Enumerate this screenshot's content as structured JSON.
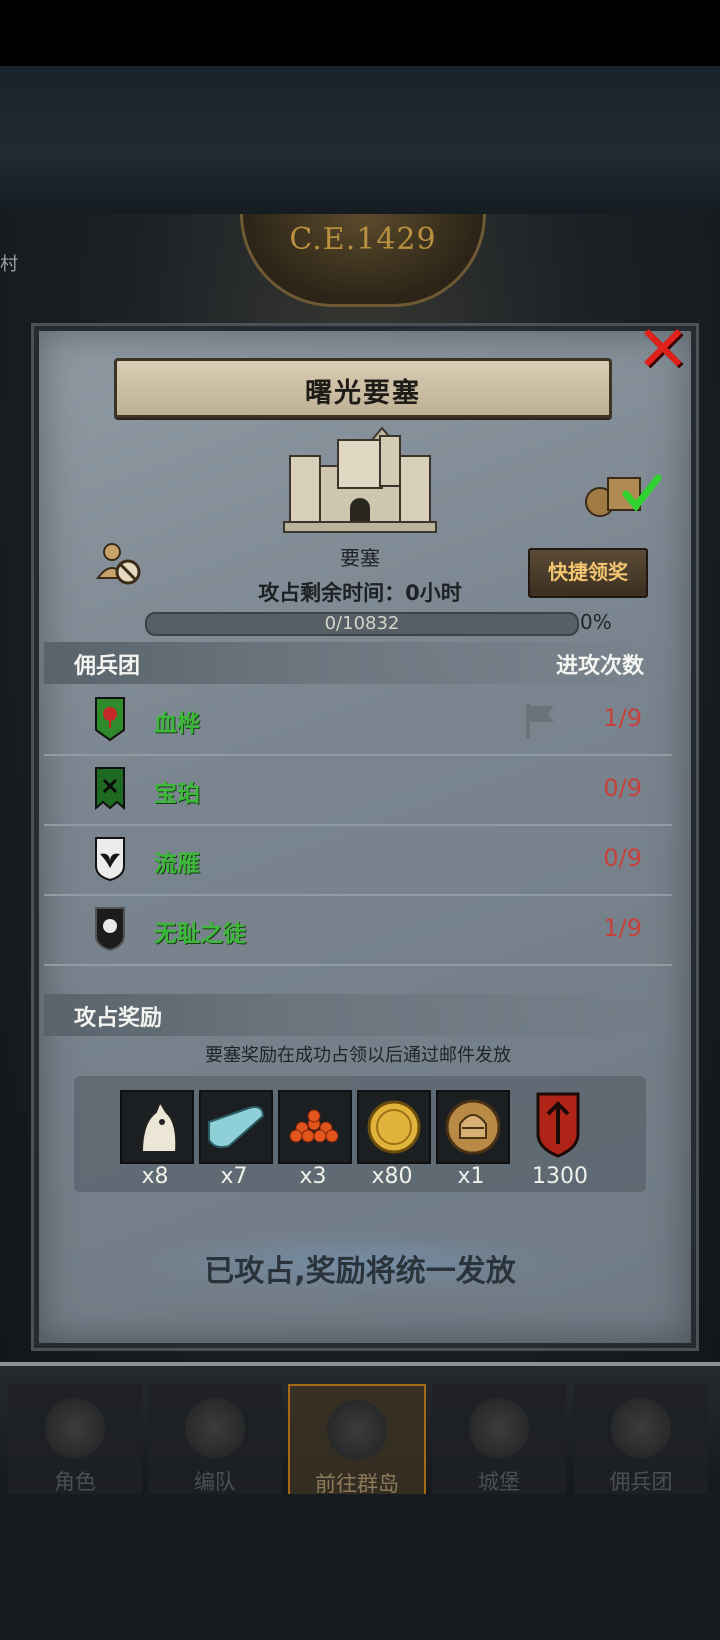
{
  "background": {
    "era_label": "C.E.1429",
    "side_label": "村"
  },
  "dialog": {
    "title": "曙光要塞",
    "fort_label": "要塞",
    "remaining_time_text": "攻占剩余时间：0小时",
    "quick_claim_label": "快捷领奖",
    "progress_text": "0/10832",
    "progress_percent_text": "0%",
    "progress_fraction": 0.0,
    "mercenary_section": {
      "header_left": "佣兵团",
      "header_right": "进攻次数",
      "rows": [
        {
          "name": "血桦",
          "count": "1/9",
          "banner_color": "#2f8a2b",
          "has_flag": true
        },
        {
          "name": "宝珀",
          "count": "0/9",
          "banner_color": "#1f6a22",
          "has_flag": false
        },
        {
          "name": "流雁",
          "count": "0/9",
          "banner_color": "#e8e8e8",
          "has_flag": false
        },
        {
          "name": "无耻之徒",
          "count": "1/9",
          "banner_color": "#1c1c1c",
          "has_flag": false
        }
      ]
    },
    "reward_section": {
      "header": "攻占奖励",
      "note": "要塞奖励在成功占领以后通过邮件发放",
      "items": [
        {
          "icon": "horse-icon",
          "qty": "x8"
        },
        {
          "icon": "cloth-icon",
          "qty": "x7"
        },
        {
          "icon": "red-beads-icon",
          "qty": "x3"
        },
        {
          "icon": "gold-coin-icon",
          "qty": "x80"
        },
        {
          "icon": "knight-helmet-coin-icon",
          "qty": "x1"
        },
        {
          "icon": "red-shield-icon",
          "qty": "1300"
        }
      ]
    },
    "status_text": "已攻占,奖励将统一发放"
  },
  "bottom_nav": {
    "tabs": [
      {
        "label": "角色",
        "active": false
      },
      {
        "label": "编队",
        "active": false
      },
      {
        "label": "前往群岛",
        "active": true
      },
      {
        "label": "城堡",
        "active": false
      },
      {
        "label": "佣兵团",
        "active": false
      }
    ]
  },
  "colors": {
    "accent_gold": "#f2c571",
    "name_green": "#3db83a",
    "count_red": "#c8403a",
    "close_red": "#e0201a"
  }
}
